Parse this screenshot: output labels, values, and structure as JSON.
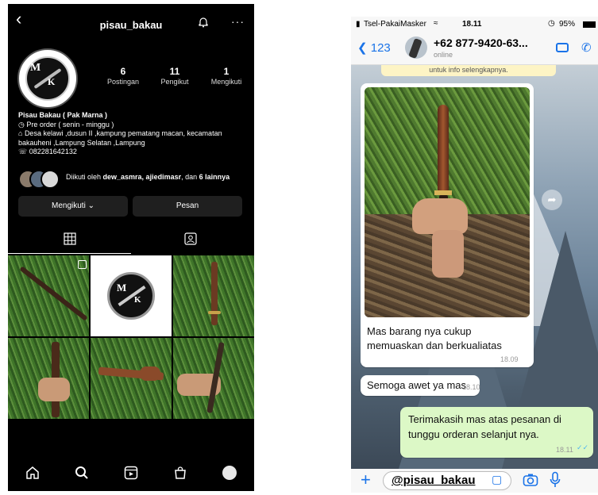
{
  "instagram": {
    "username": "pisau_bakau",
    "back_icon": "chevron-left-icon",
    "stats": [
      {
        "value": "6",
        "label": "Postingan"
      },
      {
        "value": "11",
        "label": "Pengikut"
      },
      {
        "value": "1",
        "label": "Mengikuti"
      }
    ],
    "bio": {
      "name": "Pisau Bakau ( Pak Marna )",
      "line1": "Pre order ( senin - minggu )",
      "line2": "Desa kelawi ,dusun II ,kampung pematang macan, kecamatan bakauheni ,Lampung Selatan ,Lampung",
      "line3": "082281642132"
    },
    "followed_by": {
      "prefix": "Diikuti oleh ",
      "names": "dew_asmra, ajiedimasr",
      "middle": ", dan ",
      "suffix": "6 lainnya"
    },
    "buttons": {
      "following": "Mengikuti",
      "message": "Pesan"
    },
    "logo": {
      "letter1": "M",
      "letter2": "K"
    }
  },
  "whatsapp": {
    "status": {
      "carrier": "Tsel-PakaiMasker",
      "time": "18.11",
      "battery": "95%"
    },
    "header": {
      "back_count": "123",
      "contact": "+62 877-9420-63...",
      "presence": "online"
    },
    "top_banner_text": "untuk info selengkapnya.",
    "messages": [
      {
        "text": "Mas barang nya cukup memuaskan dan berkualiatas",
        "time": "18.09",
        "direction": "in"
      },
      {
        "text": "Semoga awet ya mas",
        "time": "18.10",
        "direction": "in"
      },
      {
        "text": "Terimakasih mas atas pesanan di tunggu orderan selanjut nya.",
        "time": "18.11",
        "direction": "out"
      }
    ],
    "input_value": "@pisau_bakau"
  },
  "colors": {
    "ig_bg": "#000000",
    "wa_link": "#1a73e8",
    "wa_out": "#dcf8c6"
  }
}
